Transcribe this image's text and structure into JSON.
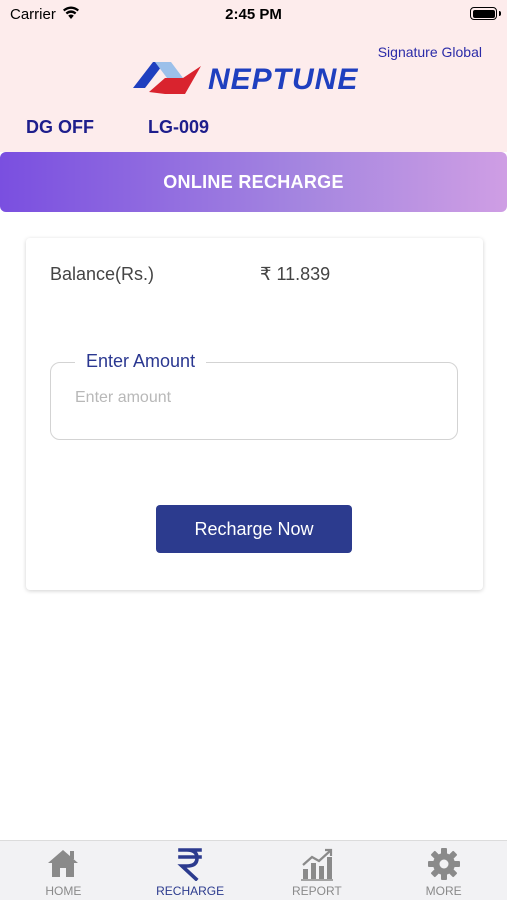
{
  "status_bar": {
    "carrier": "Carrier",
    "time": "2:45 PM",
    "battery_level": 1.0
  },
  "header": {
    "org_name": "Signature Global",
    "logo_text": "NEPTUNE",
    "dg_status": "DG OFF",
    "meter_id": "LG-009"
  },
  "banner": {
    "title": "ONLINE RECHARGE"
  },
  "card": {
    "balance_label": "Balance(Rs.)",
    "balance_value": "₹ 11.839",
    "amount_label": "Enter Amount",
    "amount_placeholder": "Enter amount",
    "amount_value": "",
    "button_label": "Recharge Now"
  },
  "tabs": [
    {
      "label": "HOME",
      "icon": "home-icon",
      "active": false
    },
    {
      "label": "RECHARGE",
      "icon": "rupee-icon",
      "active": true
    },
    {
      "label": "REPORT",
      "icon": "report-chart-icon",
      "active": false
    },
    {
      "label": "MORE",
      "icon": "gear-icon",
      "active": false
    }
  ],
  "colors": {
    "header_bg": "#fdecec",
    "primary": "#2c3b8e",
    "brand_blue": "#1f3fbf",
    "brand_red": "#d9232e",
    "banner_start": "#7a4fe0",
    "banner_end": "#cf9ee4",
    "tab_inactive": "#8a8a8a"
  }
}
